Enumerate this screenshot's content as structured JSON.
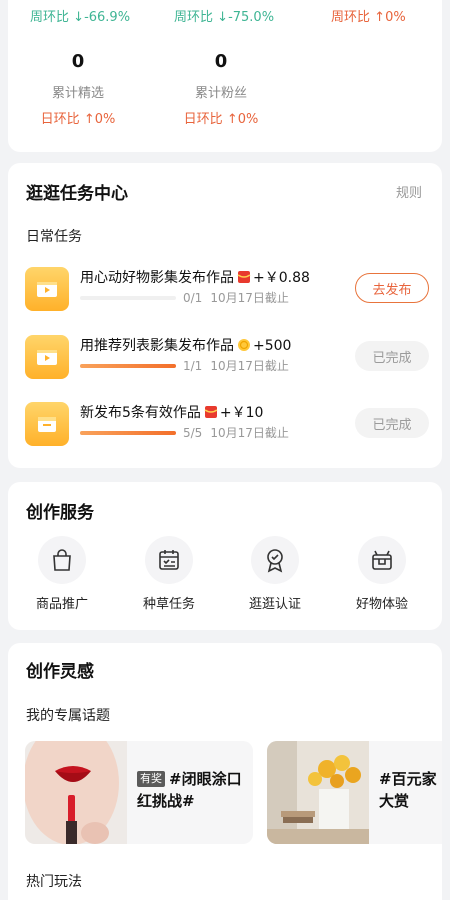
{
  "stats": {
    "top_ratios": [
      {
        "label": "周环比",
        "arrow": "↓",
        "value": "-66.9%",
        "direction": "down"
      },
      {
        "label": "周环比",
        "arrow": "↓",
        "value": "-75.0%",
        "direction": "down"
      },
      {
        "label": "周环比",
        "arrow": "↑",
        "value": "0%",
        "direction": "up"
      }
    ],
    "cells": [
      {
        "value": "0",
        "label": "累计精选",
        "ratio_label": "日环比",
        "arrow": "↑",
        "ratio_value": "0%"
      },
      {
        "value": "0",
        "label": "累计粉丝",
        "ratio_label": "日环比",
        "arrow": "↑",
        "ratio_value": "0%"
      }
    ]
  },
  "task_center": {
    "title": "逛逛任务中心",
    "rules_link": "规则",
    "subheading": "日常任务",
    "tasks": [
      {
        "title": "用心动好物影集发布作品",
        "reward_icon": "red-packet-icon",
        "reward": "+￥0.88",
        "progress": "0/1",
        "progress_fraction": 0,
        "deadline": "10月17日截止",
        "button": "去发布",
        "status": "active"
      },
      {
        "title": "用推荐列表影集发布作品",
        "reward_icon": "gold-coin-icon",
        "reward": "+500",
        "progress": "1/1",
        "progress_fraction": 1,
        "deadline": "10月17日截止",
        "button": "已完成",
        "status": "done"
      },
      {
        "title": "新发布5条有效作品",
        "reward_icon": "red-packet-icon",
        "reward": "+￥10",
        "progress": "5/5",
        "progress_fraction": 1,
        "deadline": "10月17日截止",
        "button": "已完成",
        "status": "done"
      }
    ]
  },
  "services": {
    "title": "创作服务",
    "items": [
      {
        "label": "商品推广",
        "icon": "shopping-bag-icon"
      },
      {
        "label": "种草任务",
        "icon": "calendar-checklist-icon"
      },
      {
        "label": "逛逛认证",
        "icon": "badge-ribbon-icon"
      },
      {
        "label": "好物体验",
        "icon": "gift-box-icon"
      }
    ]
  },
  "inspiration": {
    "title": "创作灵感",
    "topics_heading": "我的专属话题",
    "topics": [
      {
        "tag": "有奖",
        "line1": "#闭眼涂口",
        "line2": "红挑战#",
        "image": "lipstick-photo"
      },
      {
        "tag": "",
        "line1": "#百元家",
        "line2": "大赏",
        "image": "flower-vase-photo"
      }
    ],
    "hot_heading": "热门玩法"
  },
  "colors": {
    "accent_orange": "#e8643c",
    "ratio_down_green": "#3fb594",
    "progress_gradient": [
      "#f9a25b",
      "#f36f2a"
    ],
    "task_icon_gold": "#ffb12a"
  }
}
